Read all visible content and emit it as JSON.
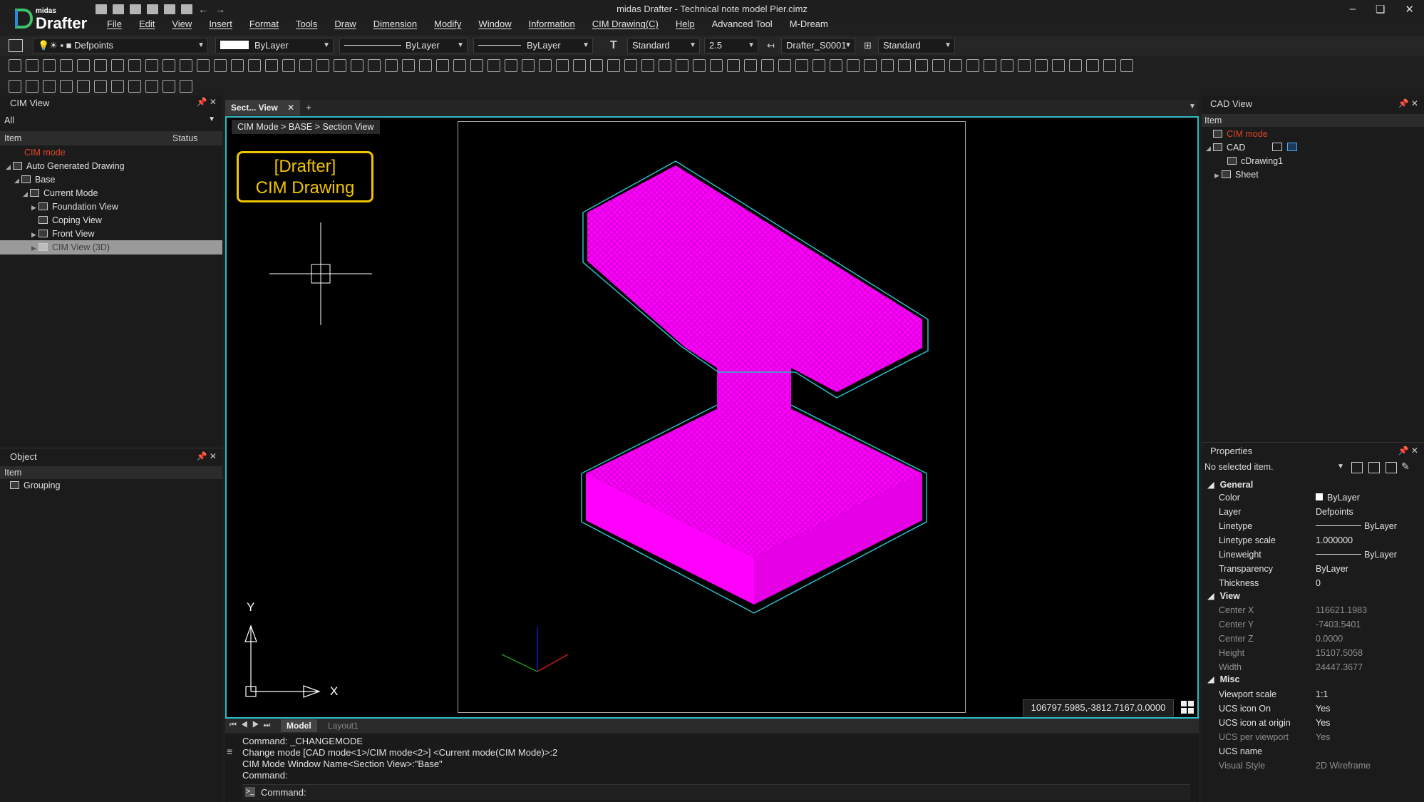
{
  "app": {
    "logo_small": "midas",
    "logo_big": "Drafter",
    "window_title": "midas Drafter - Technical note model Pier.cimz",
    "window_controls": [
      "–",
      "❏",
      "✕"
    ]
  },
  "menu": [
    "File",
    "Edit",
    "View",
    "Insert",
    "Format",
    "Tools",
    "Draw",
    "Dimension",
    "Modify",
    "Window",
    "Information",
    "CIM Drawing(C)",
    "Help",
    "Advanced Tool",
    "M-Dream"
  ],
  "props_bar": {
    "layer": "Defpoints",
    "color": "ByLayer",
    "linetype": "ByLayer",
    "lineweight": "ByLayer",
    "text_style": "Standard",
    "text_height": "2.5",
    "dim_style": "Drafter_S0001",
    "table_style": "Standard"
  },
  "cim_view": {
    "title": "CIM View",
    "filter": "All",
    "col_item": "Item",
    "col_status": "Status",
    "rows": [
      "CIM mode",
      "Auto Generated Drawing",
      "Base",
      "Current Mode",
      "Foundation View",
      "Coping View",
      "Front View",
      "CIM View (3D)"
    ]
  },
  "object_panel": {
    "title": "Object",
    "col_item": "Item",
    "rows": [
      "Grouping"
    ]
  },
  "doc_tab": {
    "label": "Sect... View",
    "add": "+"
  },
  "viewport": {
    "breadcrumb": "CIM Mode > BASE > Section View",
    "label_line1": "[Drafter]",
    "label_line2": "CIM Drawing",
    "axis_y": "Y",
    "axis_x": "X",
    "coords": "106797.5985,-3812.7167,0.0000"
  },
  "layout_tabs": [
    "Model",
    "Layout1"
  ],
  "command": {
    "lines": [
      "Command:  _CHANGEMODE",
      "Change mode [CAD mode<1>/CIM mode<2>] <Current mode(CIM Mode)>:2",
      "CIM Mode Window Name<Section View>:\"Base\"",
      "Command:"
    ],
    "prompt": "Command:"
  },
  "cad_view": {
    "title": "CAD View",
    "col_item": "Item",
    "rows": [
      "CIM mode",
      "CAD",
      "cDrawing1",
      "Sheet"
    ]
  },
  "properties": {
    "title": "Properties",
    "selection": "No selected item.",
    "sections": {
      "general": "General",
      "view": "View",
      "misc": "Misc"
    },
    "general": [
      [
        "Color",
        "ByLayer"
      ],
      [
        "Layer",
        "Defpoints"
      ],
      [
        "Linetype",
        "ByLayer"
      ],
      [
        "Linetype scale",
        "1.000000"
      ],
      [
        "Lineweight",
        "ByLayer"
      ],
      [
        "Transparency",
        "ByLayer"
      ],
      [
        "Thickness",
        "0"
      ]
    ],
    "view": [
      [
        "Center X",
        "116621.1983"
      ],
      [
        "Center Y",
        "-7403.5401"
      ],
      [
        "Center Z",
        "0.0000"
      ],
      [
        "Height",
        "15107.5058"
      ],
      [
        "Width",
        "24447.3677"
      ]
    ],
    "misc": [
      [
        "Viewport scale",
        "1:1"
      ],
      [
        "UCS icon On",
        "Yes"
      ],
      [
        "UCS icon at origin",
        "Yes"
      ],
      [
        "UCS per viewport",
        "Yes"
      ],
      [
        "UCS name",
        ""
      ],
      [
        "Visual Style",
        "2D Wireframe"
      ]
    ]
  },
  "colors": {
    "accent_cyan": "#2bbcc4",
    "model_magenta": "#ff00ff",
    "label_yellow": "#f2c400",
    "cim_mode_red": "#e0452a"
  }
}
